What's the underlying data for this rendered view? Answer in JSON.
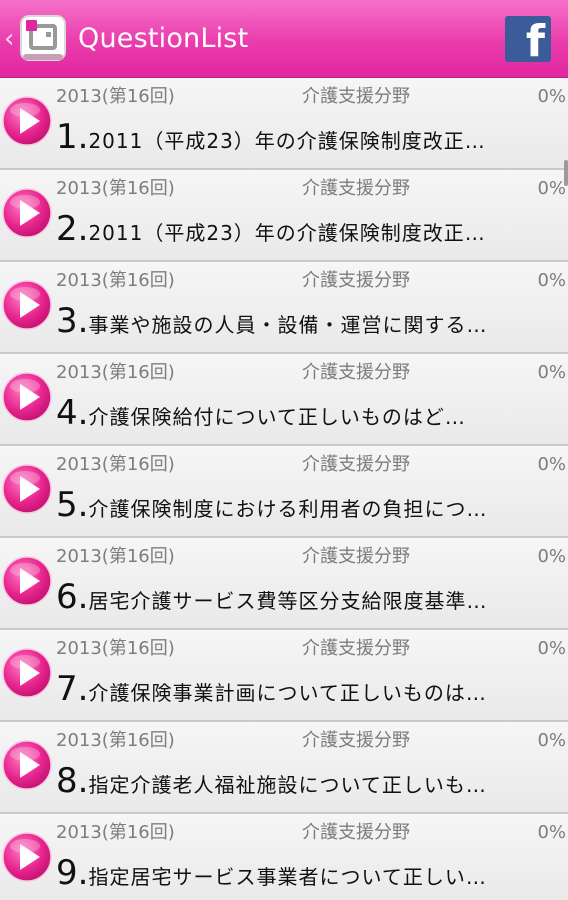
{
  "actionbar": {
    "title": "QuestionList",
    "up_glyph": "‹",
    "app_icon": "app-logo-icon",
    "share_icon": "facebook-icon",
    "share_letter": "f",
    "brand_color": "#e83aab",
    "facebook_color": "#3b5b99"
  },
  "list": {
    "play_icon": "play-icon",
    "play_color": "#e8268f",
    "items": [
      {
        "year": "2013(第16回)",
        "category": "介護支援分野",
        "percent": "0%",
        "number": "1.",
        "text": "2011（平成23）年の介護保険制度改正…"
      },
      {
        "year": "2013(第16回)",
        "category": "介護支援分野",
        "percent": "0%",
        "number": "2.",
        "text": "2011（平成23）年の介護保険制度改正…"
      },
      {
        "year": "2013(第16回)",
        "category": "介護支援分野",
        "percent": "0%",
        "number": "3.",
        "text": "事業や施設の人員・設備・運営に関する…"
      },
      {
        "year": "2013(第16回)",
        "category": "介護支援分野",
        "percent": "0%",
        "number": "4.",
        "text": "介護保険給付について正しいものはど…"
      },
      {
        "year": "2013(第16回)",
        "category": "介護支援分野",
        "percent": "0%",
        "number": "5.",
        "text": "介護保険制度における利用者の負担につ…"
      },
      {
        "year": "2013(第16回)",
        "category": "介護支援分野",
        "percent": "0%",
        "number": "6.",
        "text": "居宅介護サービス費等区分支給限度基準…"
      },
      {
        "year": "2013(第16回)",
        "category": "介護支援分野",
        "percent": "0%",
        "number": "7.",
        "text": "介護保険事業計画について正しいものは…"
      },
      {
        "year": "2013(第16回)",
        "category": "介護支援分野",
        "percent": "0%",
        "number": "8.",
        "text": "指定介護老人福祉施設について正しいも…"
      },
      {
        "year": "2013(第16回)",
        "category": "介護支援分野",
        "percent": "0%",
        "number": "9.",
        "text": "指定居宅サービス事業者について正しい…"
      }
    ]
  }
}
